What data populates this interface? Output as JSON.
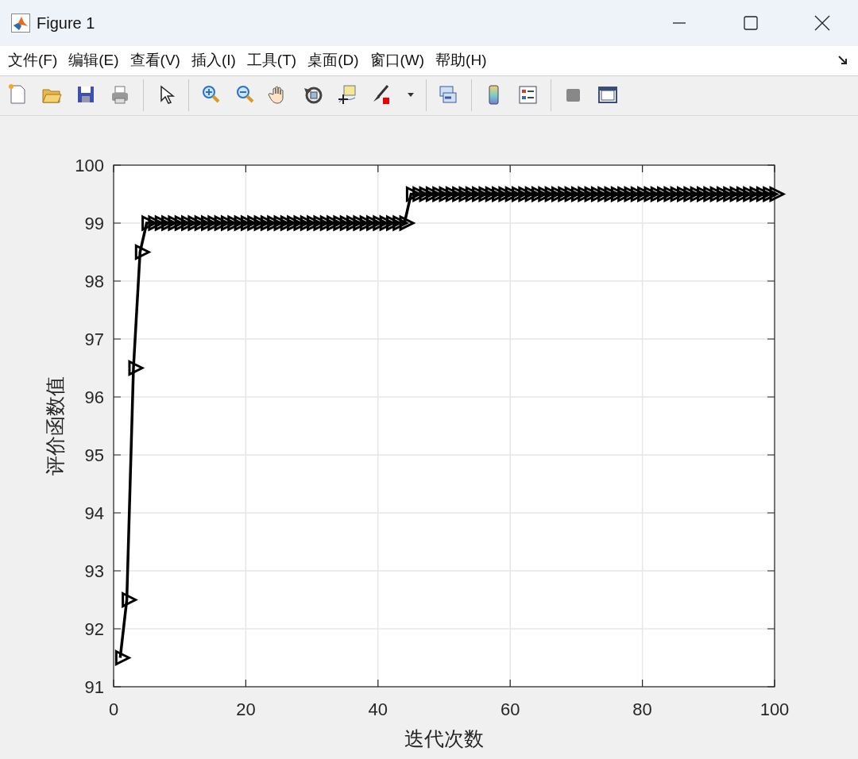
{
  "window": {
    "title": "Figure 1"
  },
  "menu": [
    "文件(F)",
    "编辑(E)",
    "查看(V)",
    "插入(I)",
    "工具(T)",
    "桌面(D)",
    "窗口(W)",
    "帮助(H)"
  ],
  "axes": {
    "chart_data": {
      "type": "line",
      "xlabel": "迭代次数",
      "ylabel": "评价函数值",
      "xlim": [
        0,
        100
      ],
      "ylim": [
        91,
        100
      ],
      "xticks": [
        0,
        20,
        40,
        60,
        80,
        100
      ],
      "yticks": [
        91,
        92,
        93,
        94,
        95,
        96,
        97,
        98,
        99,
        100
      ],
      "x": [
        1,
        2,
        3,
        4,
        5,
        6,
        7,
        8,
        9,
        10,
        11,
        12,
        13,
        14,
        15,
        16,
        17,
        18,
        19,
        20,
        21,
        22,
        23,
        24,
        25,
        26,
        27,
        28,
        29,
        30,
        31,
        32,
        33,
        34,
        35,
        36,
        37,
        38,
        39,
        40,
        41,
        42,
        43,
        44,
        45,
        46,
        47,
        48,
        49,
        50,
        51,
        52,
        53,
        54,
        55,
        56,
        57,
        58,
        59,
        60,
        61,
        62,
        63,
        64,
        65,
        66,
        67,
        68,
        69,
        70,
        71,
        72,
        73,
        74,
        75,
        76,
        77,
        78,
        79,
        80,
        81,
        82,
        83,
        84,
        85,
        86,
        87,
        88,
        89,
        90,
        91,
        92,
        93,
        94,
        95,
        96,
        97,
        98,
        99,
        100
      ],
      "grid": true,
      "series": [
        {
          "color": "#000000",
          "marker": "triangle",
          "values": [
            91.5,
            92.5,
            96.5,
            98.5,
            99,
            99,
            99,
            99,
            99,
            99,
            99,
            99,
            99,
            99,
            99,
            99,
            99,
            99,
            99,
            99,
            99,
            99,
            99,
            99,
            99,
            99,
            99,
            99,
            99,
            99,
            99,
            99,
            99,
            99,
            99,
            99,
            99,
            99,
            99,
            99,
            99,
            99,
            99,
            99,
            99.5,
            99.5,
            99.5,
            99.5,
            99.5,
            99.5,
            99.5,
            99.5,
            99.5,
            99.5,
            99.5,
            99.5,
            99.5,
            99.5,
            99.5,
            99.5,
            99.5,
            99.5,
            99.5,
            99.5,
            99.5,
            99.5,
            99.5,
            99.5,
            99.5,
            99.5,
            99.5,
            99.5,
            99.5,
            99.5,
            99.5,
            99.5,
            99.5,
            99.5,
            99.5,
            99.5,
            99.5,
            99.5,
            99.5,
            99.5,
            99.5,
            99.5,
            99.5,
            99.5,
            99.5,
            99.5,
            99.5,
            99.5,
            99.5,
            99.5,
            99.5,
            99.5,
            99.5,
            99.5,
            99.5,
            99.5
          ]
        }
      ]
    }
  }
}
